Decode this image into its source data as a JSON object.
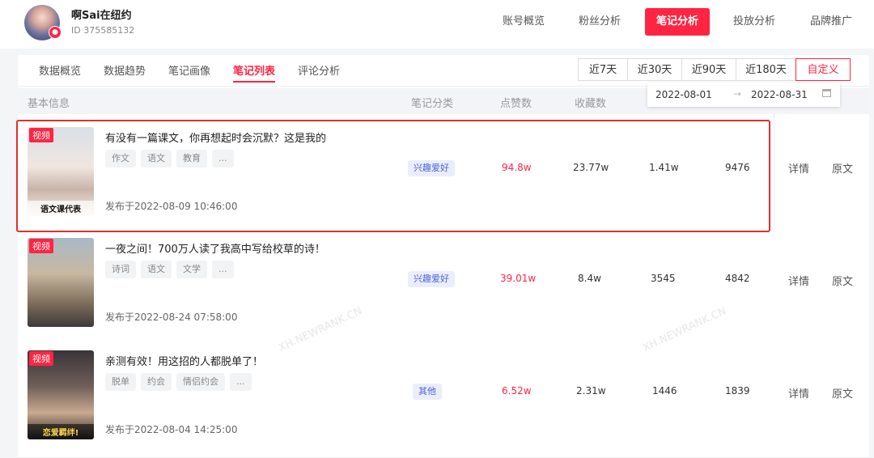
{
  "account": {
    "name": "啊Sai在纽约",
    "id_text": "ID 375585132"
  },
  "top_nav": [
    "账号概览",
    "粉丝分析",
    "笔记分析",
    "投放分析",
    "品牌推广"
  ],
  "sub_tabs": [
    "数据概览",
    "数据趋势",
    "笔记画像",
    "笔记列表",
    "评论分析"
  ],
  "date_range": {
    "options": [
      "近7天",
      "近30天",
      "近90天",
      "近180天",
      "自定义"
    ],
    "active": "自定义",
    "start": "2022-08-01",
    "end": "2022-08-31",
    "arrow": "→"
  },
  "table": {
    "headers": {
      "info": "基本信息",
      "category": "笔记分类",
      "likes": "点赞数",
      "collects": "收藏数"
    },
    "rows": [
      {
        "badge": "视频",
        "thumb_caption": "语文课代表",
        "title": "有没有一篇课文，你再想起时会沉默？这是我的",
        "tags": [
          "作文",
          "语文",
          "教育",
          "..."
        ],
        "published": "发布于2022-08-09 10:46:00",
        "category": "兴趣爱好",
        "likes": "94.8w",
        "collects": "23.77w",
        "col3": "1.41w",
        "col4": "9476",
        "detail": "详情",
        "original": "原文"
      },
      {
        "badge": "视频",
        "thumb_caption": "",
        "title": "一夜之间！700万人读了我高中写给校草的诗！",
        "tags": [
          "诗词",
          "语文",
          "文学",
          "..."
        ],
        "published": "发布于2022-08-24 07:58:00",
        "category": "兴趣爱好",
        "likes": "39.01w",
        "collects": "8.4w",
        "col3": "3545",
        "col4": "4842",
        "detail": "详情",
        "original": "原文"
      },
      {
        "badge": "视频",
        "thumb_caption": "恋爱羁绊!",
        "title": "亲测有效！用这招的人都脱单了！",
        "tags": [
          "脱单",
          "约会",
          "情侣约会",
          "..."
        ],
        "published": "发布于2022-08-04 14:25:00",
        "category": "其他",
        "likes": "6.52w",
        "collects": "2.31w",
        "col3": "1446",
        "col4": "1839",
        "detail": "详情",
        "original": "原文"
      }
    ]
  },
  "watermark": "XH.NEWRANK.CN",
  "colors": {
    "accent": "#ff2442",
    "highlight_border": "#e0302e",
    "category_bg": "#eaeefc",
    "category_text": "#4a64d8"
  }
}
